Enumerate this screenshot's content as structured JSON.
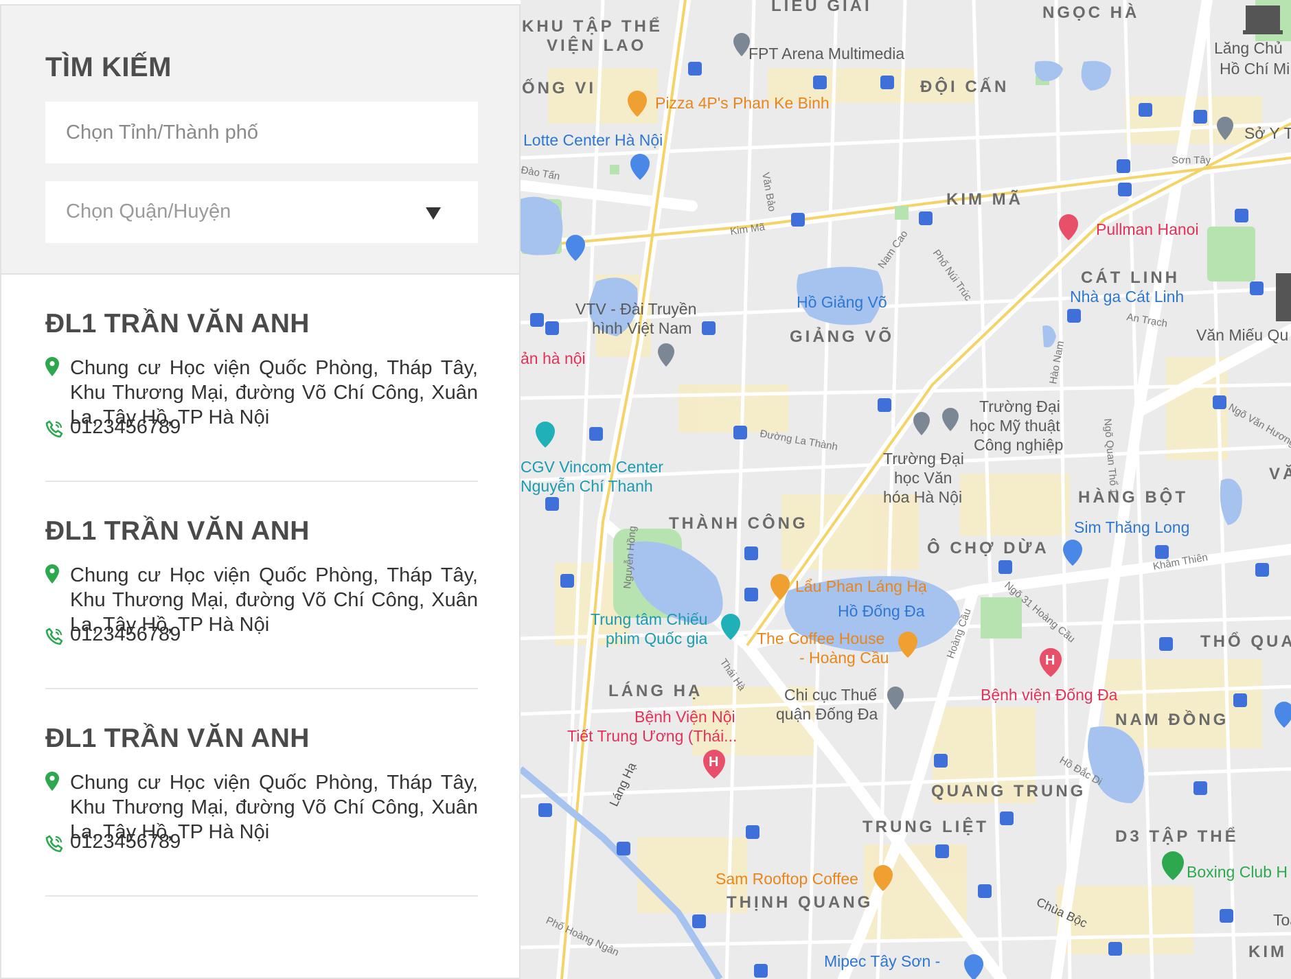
{
  "search": {
    "title": "TÌM KIẾM",
    "province_placeholder": "Chọn Tỉnh/Thành phố",
    "district_placeholder": "Chọn Quận/Huyện"
  },
  "stores": [
    {
      "name": "ĐL1 TRẦN VĂN ANH",
      "address": "Chung cư Học viện Quốc Phòng, Tháp Tây, Khu Thương Mại, đường Võ Chí Công, Xuân La, Tây Hồ, TP Hà Nội",
      "phone": "0123456789"
    },
    {
      "name": "ĐL1 TRẦN VĂN ANH",
      "address": "Chung cư Học viện Quốc Phòng, Tháp Tây, Khu Thương Mại, đường Võ Chí Công, Xuân La, Tây Hồ, TP Hà Nội",
      "phone": "0123456789"
    },
    {
      "name": "ĐL1 TRẦN VĂN ANH",
      "address": "Chung cư Học viện Quốc Phòng, Tháp Tây, Khu Thương Mại, đường Võ Chí Công, Xuân La, Tây Hồ, TP Hà Nội",
      "phone": "0123456789"
    }
  ],
  "map": {
    "areas": [
      "KHU TẬP THỂ",
      "VIỆN LAO",
      "LIỄU GIAI",
      "NGỌC HÀ",
      "ỐNG VI",
      "ĐỘI CẤN",
      "KIM MÃ",
      "CÁT LINH",
      "GIẢNG VÕ",
      "HÀNG BỘT",
      "THÀNH CÔNG",
      "Ô CHỢ DỪA",
      "LÁNG HẠ",
      "THỔ QUAN",
      "NAM ĐỒNG",
      "QUANG TRUNG",
      "TRUNG LIỆT",
      "D3 TẬP THỂ",
      "THỊNH QUANG",
      "KIM",
      "VĂ"
    ],
    "pois": [
      "FPT Arena Multimedia",
      "Pizza 4P's Phan Ke Binh",
      "Lotte Center Hà Nội",
      "Lăng Chủ",
      "Hồ Chí Mi",
      "Sở Y T",
      "Pullman Hanoi",
      "Nhà ga Cát Linh",
      "Văn Miếu Qu",
      "VTV - Đài Truyền",
      "hình Việt Nam",
      "Hồ Giảng Võ",
      "ản hà nội",
      "Trường Đại",
      "học Mỹ thuật",
      "Công nghiệp",
      "Trường Đại",
      "học Văn",
      "hóa Hà Nội",
      "CGV Vincom Center",
      "Nguyễn Chí Thanh",
      "Sim Thăng Long",
      "Lẩu Phan Láng Hạ",
      "Hồ Đống Đa",
      "Trung tâm Chiếu",
      "phim Quốc gia",
      "The Coffee House",
      "- Hoàng Cầu",
      "Bệnh viện Đống Đa",
      "Chi cục Thuế",
      "quận Đống Đa",
      "Bệnh Viện Nội",
      "Tiết Trung Ương (Thái...",
      "Boxing Club H",
      "Sam Rooftop Coffee",
      "Mipec Tây Sơn -",
      "Toà"
    ],
    "streets": [
      "Kim Mã",
      "Văn Bảo",
      "Đào Tấn",
      "Nam Cao",
      "Phố Núi Trúc",
      "An Trạch",
      "Hào Nam",
      "Đường La Thành",
      "Ngõ Quan Thổ 1",
      "Ngõ Văn Hương",
      "Khâm Thiên",
      "Ngõ 31 Hoàng Cầu",
      "Hoàng Cầu",
      "Nguyễn Hồng",
      "Thái Hà",
      "Láng Hạ",
      "Hồ Đắc Di",
      "Chùa Bộc",
      "Phố Hoàng Ngân",
      "Sơn Tây"
    ]
  }
}
